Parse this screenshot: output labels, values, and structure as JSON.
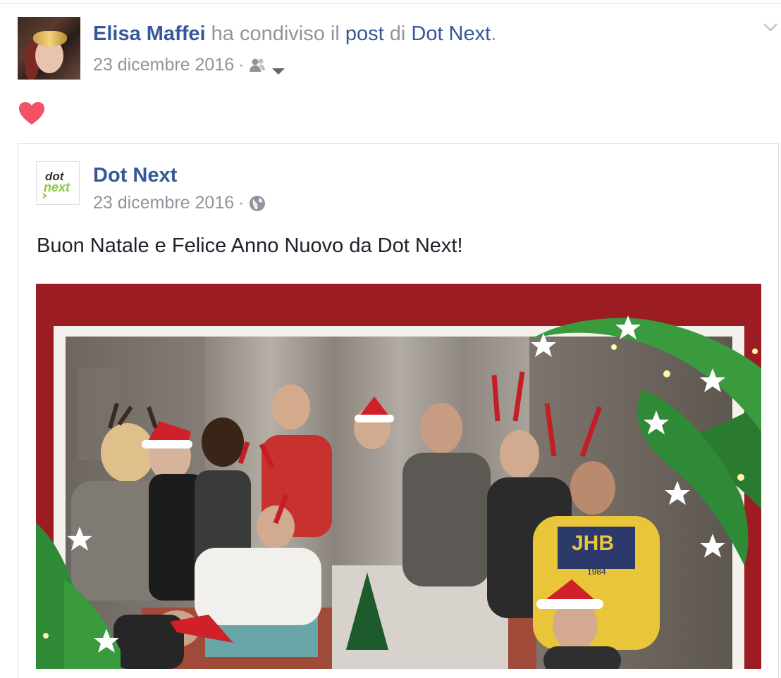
{
  "share_header": {
    "author": "Elisa Maffei",
    "action_prefix": "ha condiviso il",
    "post_word": "post",
    "of_word": "di",
    "source_page": "Dot Next",
    "period": ".",
    "date": "23 dicembre 2016",
    "separator": "·",
    "audience_icon": "friends-icon",
    "menu_icon": "chevron-down-icon"
  },
  "reaction": {
    "icon": "heart-icon",
    "color": "#f25268"
  },
  "shared_post": {
    "page_name": "Dot Next",
    "logo_text_top": "dot",
    "logo_text_bottom": "next",
    "date": "23 dicembre 2016",
    "separator": "·",
    "audience_icon": "globe-icon",
    "message": "Buon Natale e Felice Anno Nuovo da Dot Next!",
    "photo_caption_shirt": "JHB",
    "photo_caption_number": "1984"
  },
  "colors": {
    "link": "#365899",
    "meta": "#90949c",
    "text": "#1d2129",
    "frame_red": "#9c1c24",
    "logo_green": "#8cc63f"
  }
}
